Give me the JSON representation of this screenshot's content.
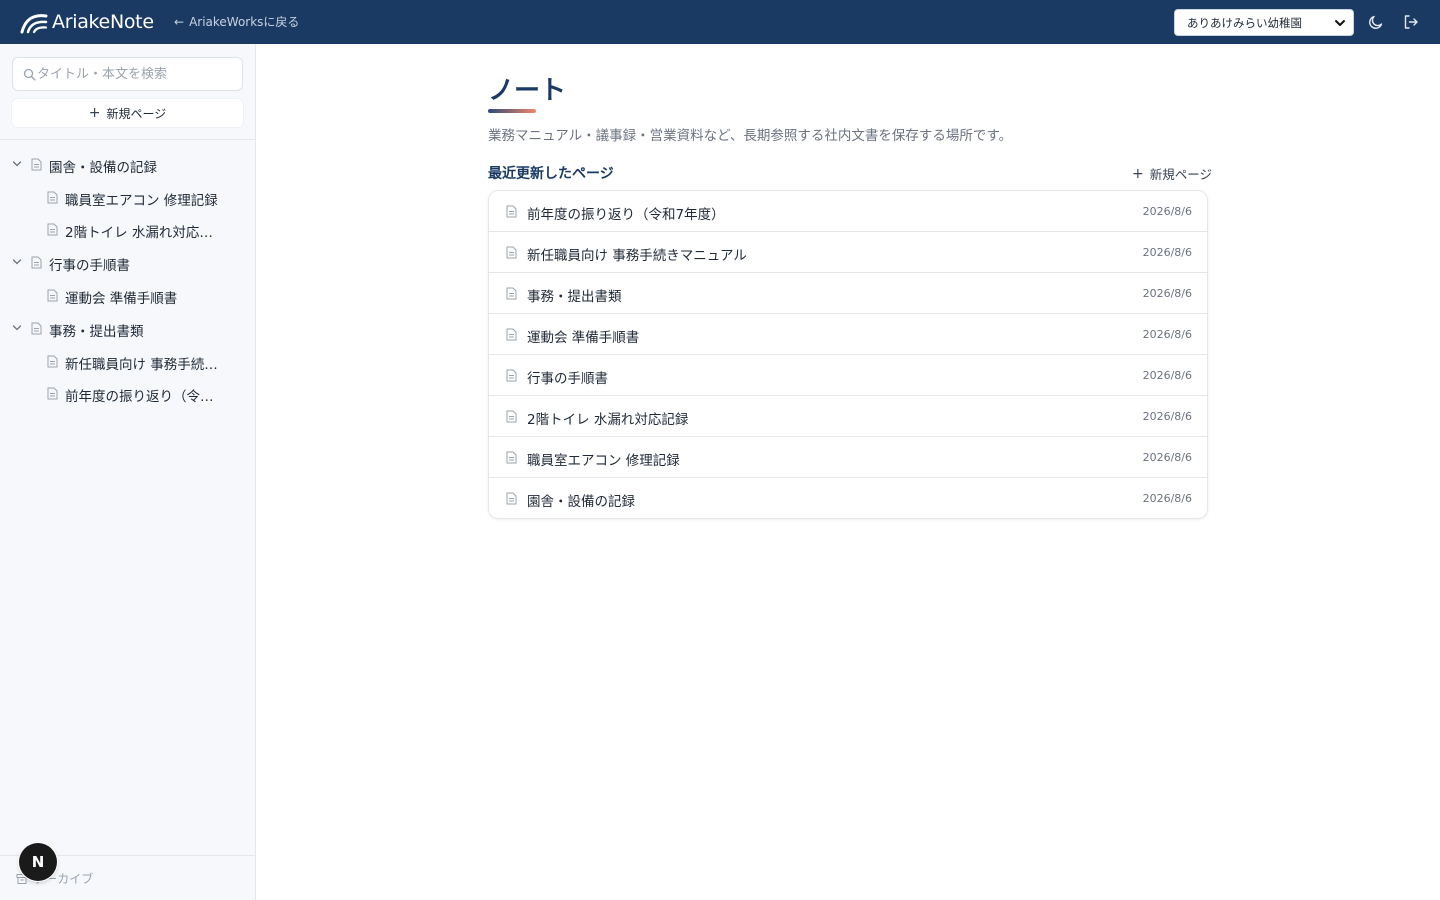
{
  "header": {
    "brand": "AriakeNote",
    "back_label": "AriakeWorksに戻る",
    "org_selected": "ありあけみらい幼稚園",
    "bg_color": "#1b3a63"
  },
  "sidebar": {
    "search_placeholder": "タイトル・本文を検索",
    "new_page_label": "新規ページ",
    "tree": [
      {
        "label": "園舎・設備の記録",
        "children": [
          "職員室エアコン 修理記録",
          "2階トイレ 水漏れ対応記録"
        ]
      },
      {
        "label": "行事の手順書",
        "children": [
          "運動会 準備手順書"
        ]
      },
      {
        "label": "事務・提出書類",
        "children": [
          "新任職員向け 事務手続きマニュアル",
          "前年度の振り返り（令和7年度）"
        ]
      }
    ],
    "archive_label": "アーカイブ",
    "avatar_letter": "N"
  },
  "main": {
    "title": "ノート",
    "subtitle": "業務マニュアル・議事録・営業資料など、長期参照する社内文書を保存する場所です。",
    "section_title": "最近更新したページ",
    "new_page_label": "新規ページ",
    "pages": [
      {
        "name": "前年度の振り返り（令和7年度）",
        "date": "2026/8/6"
      },
      {
        "name": "新任職員向け 事務手続きマニュアル",
        "date": "2026/8/6"
      },
      {
        "name": "事務・提出書類",
        "date": "2026/8/6"
      },
      {
        "name": "運動会 準備手順書",
        "date": "2026/8/6"
      },
      {
        "name": "行事の手順書",
        "date": "2026/8/6"
      },
      {
        "name": "2階トイレ 水漏れ対応記録",
        "date": "2026/8/6"
      },
      {
        "name": "職員室エアコン 修理記録",
        "date": "2026/8/6"
      },
      {
        "name": "園舎・設備の記録",
        "date": "2026/8/6"
      }
    ]
  }
}
